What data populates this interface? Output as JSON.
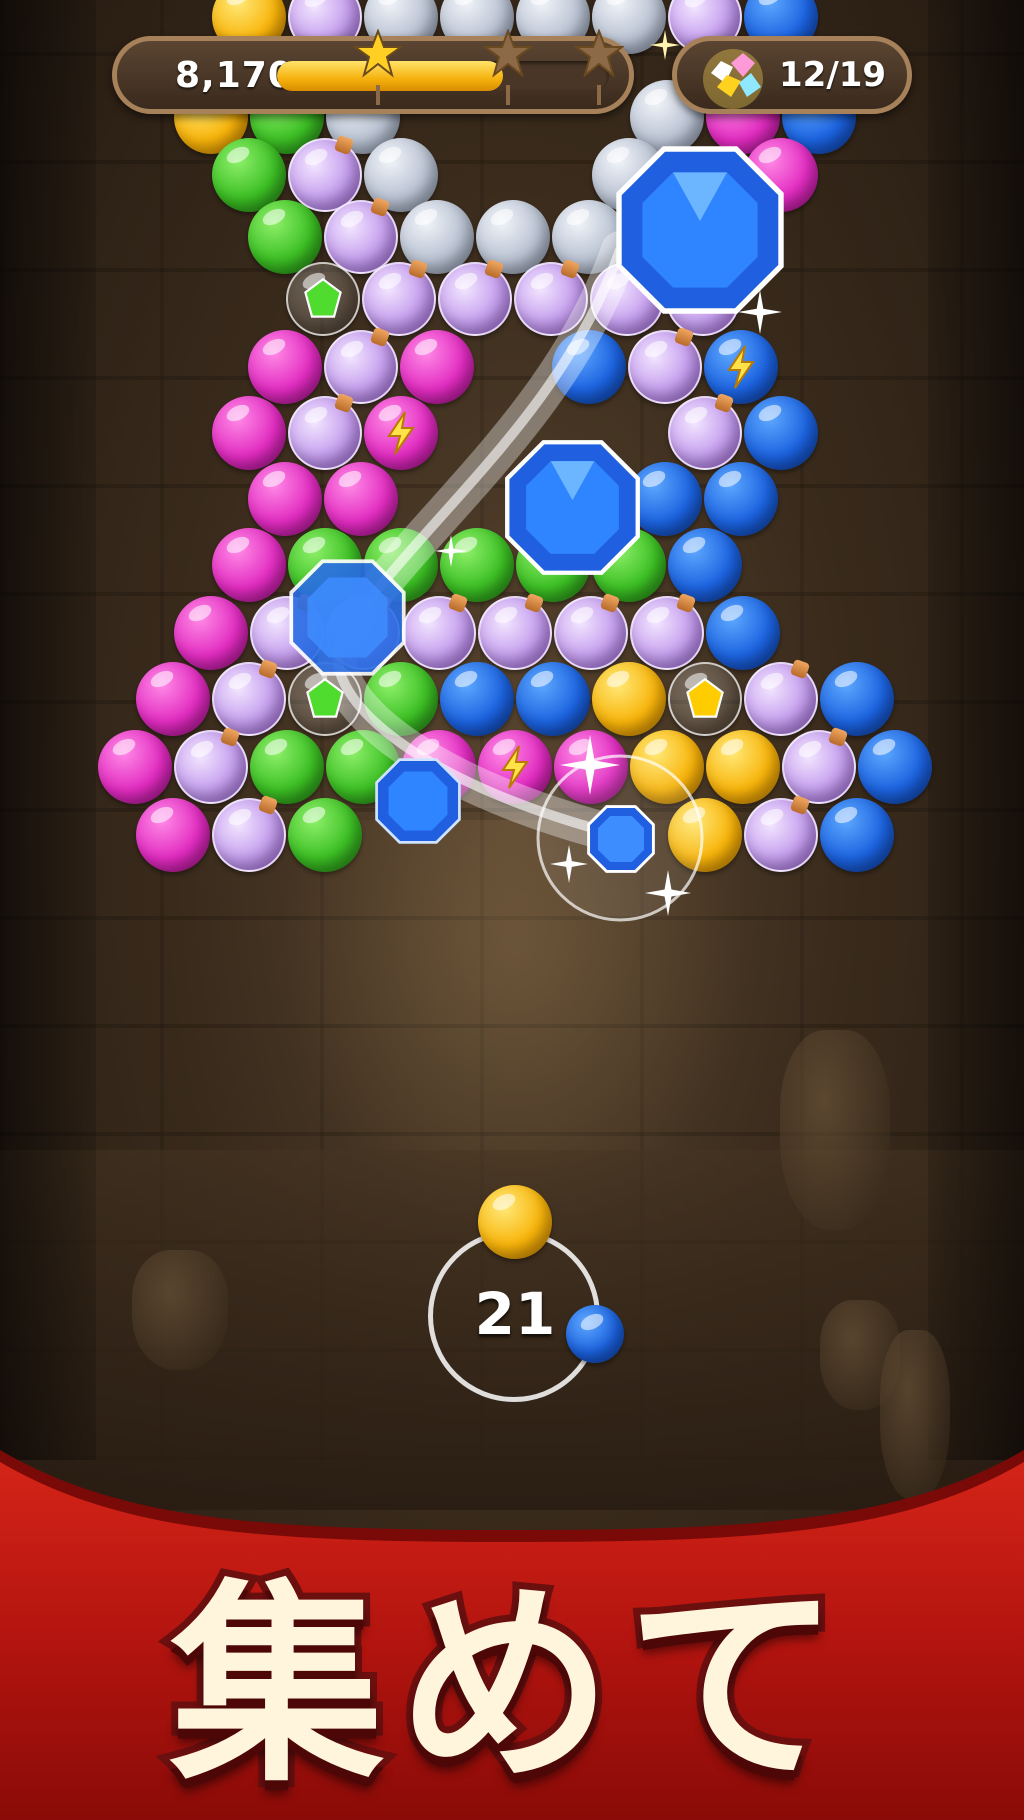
{
  "hud": {
    "score": "8,170",
    "progress": 0.68,
    "stars_earned": 1,
    "stars_total": 3,
    "gems_collected": "12/19"
  },
  "board": {
    "bubble_colors": [
      "yellow",
      "gray",
      "green",
      "pink",
      "blue",
      "purple-potion",
      "clear-with-gem"
    ],
    "gem_colors": [
      "blue",
      "green",
      "yellow"
    ],
    "special_bubbles": [
      "lightning"
    ]
  },
  "shooter": {
    "moves_left": "21",
    "current_bubble": "yellow",
    "next_bubble": "blue"
  },
  "banner": {
    "text": "集めて"
  },
  "colors": {
    "banner_red": "#b3140f",
    "progress_gold": "#f5b10d",
    "hud_border": "#a68159"
  }
}
